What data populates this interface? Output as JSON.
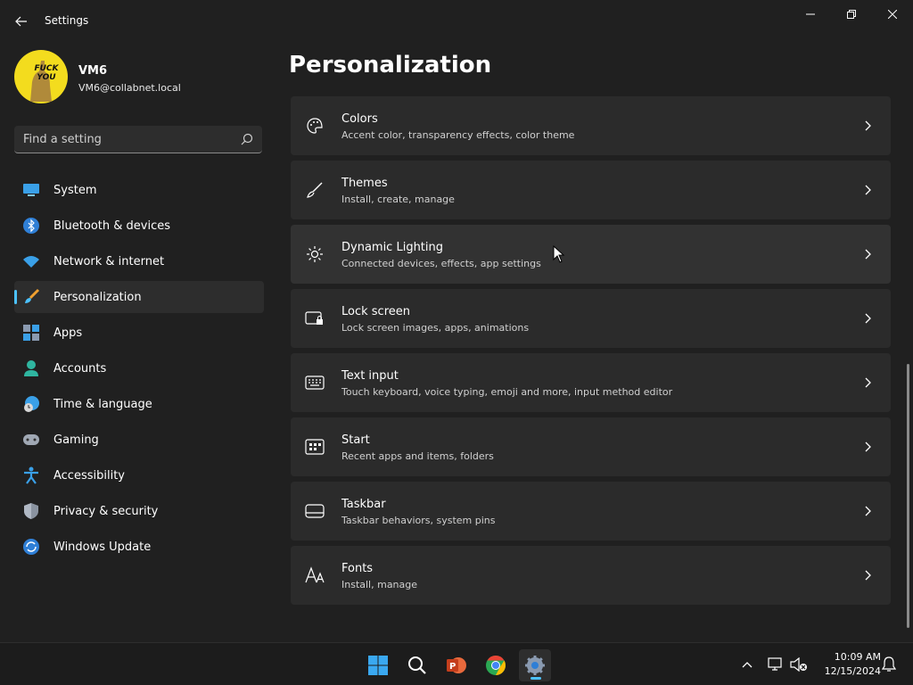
{
  "window": {
    "title": "Settings"
  },
  "profile": {
    "avatar_text": "FUCK YOU",
    "name": "VM6",
    "email": "VM6@collabnet.local"
  },
  "search": {
    "placeholder": "Find a setting"
  },
  "sidebar": {
    "items": [
      {
        "label": "System",
        "icon": "monitor-icon"
      },
      {
        "label": "Bluetooth & devices",
        "icon": "bluetooth-icon"
      },
      {
        "label": "Network & internet",
        "icon": "wifi-icon"
      },
      {
        "label": "Personalization",
        "icon": "brush-icon",
        "active": true
      },
      {
        "label": "Apps",
        "icon": "apps-icon"
      },
      {
        "label": "Accounts",
        "icon": "person-icon"
      },
      {
        "label": "Time & language",
        "icon": "globe-clock-icon"
      },
      {
        "label": "Gaming",
        "icon": "gamepad-icon"
      },
      {
        "label": "Accessibility",
        "icon": "accessibility-icon"
      },
      {
        "label": "Privacy & security",
        "icon": "shield-icon"
      },
      {
        "label": "Windows Update",
        "icon": "update-icon"
      }
    ]
  },
  "main": {
    "title": "Personalization",
    "cards": [
      {
        "title": "Colors",
        "subtitle": "Accent color, transparency effects, color theme",
        "icon": "palette-icon"
      },
      {
        "title": "Themes",
        "subtitle": "Install, create, manage",
        "icon": "brush-icon"
      },
      {
        "title": "Dynamic Lighting",
        "subtitle": "Connected devices, effects, app settings",
        "icon": "lighting-icon"
      },
      {
        "title": "Lock screen",
        "subtitle": "Lock screen images, apps, animations",
        "icon": "lock-screen-icon"
      },
      {
        "title": "Text input",
        "subtitle": "Touch keyboard, voice typing, emoji and more, input method editor",
        "icon": "keyboard-icon"
      },
      {
        "title": "Start",
        "subtitle": "Recent apps and items, folders",
        "icon": "start-icon"
      },
      {
        "title": "Taskbar",
        "subtitle": "Taskbar behaviors, system pins",
        "icon": "taskbar-icon"
      },
      {
        "title": "Fonts",
        "subtitle": "Install, manage",
        "icon": "fonts-icon"
      }
    ]
  },
  "taskbar": {
    "apps": [
      "windows-start-icon",
      "search-icon",
      "powerpoint-icon",
      "chrome-icon",
      "settings-gear-icon"
    ],
    "clock": {
      "time": "10:09 AM",
      "date": "12/15/2024"
    }
  },
  "colors": {
    "accent": "#4cc2ff",
    "background": "#202020",
    "card": "#2b2b2b"
  }
}
